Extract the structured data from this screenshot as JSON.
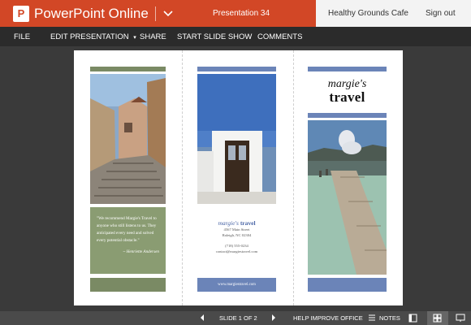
{
  "app": {
    "logo_letter": "P",
    "name": "PowerPoint Online",
    "document_title": "Presentation 34",
    "owner": "Healthy Grounds Cafe",
    "sign_out": "Sign out",
    "help": "?"
  },
  "menu": {
    "file": "FILE",
    "edit": "EDIT PRESENTATION",
    "edit_arrow": "▾",
    "share": "SHARE",
    "slideshow": "START SLIDE SHOW",
    "comments": "COMMENTS"
  },
  "slide": {
    "quote": "\"We recommend Margie's Travel to anyone who still listens to us. They anticipated every need and solved every potential obstacle.\"",
    "quote_author": "~ Henriette Andersen",
    "brand_script": "margie's",
    "brand_bold": "travel",
    "address1": "4567 Main Street",
    "address2": "Raleigh, NC 02304",
    "phone": "(718) 555-0234",
    "email": "contact@margiestravel.com",
    "website": "www.margiestravel.com",
    "cover_line1": "margie's",
    "cover_line2": "travel"
  },
  "status": {
    "slide_indicator": "SLIDE 1 OF 2",
    "help_improve": "HELP IMPROVE OFFICE",
    "notes": "NOTES"
  },
  "colors": {
    "brand": "#d24726",
    "accent_green": "#7a8a64",
    "accent_blue": "#6b84b8"
  }
}
